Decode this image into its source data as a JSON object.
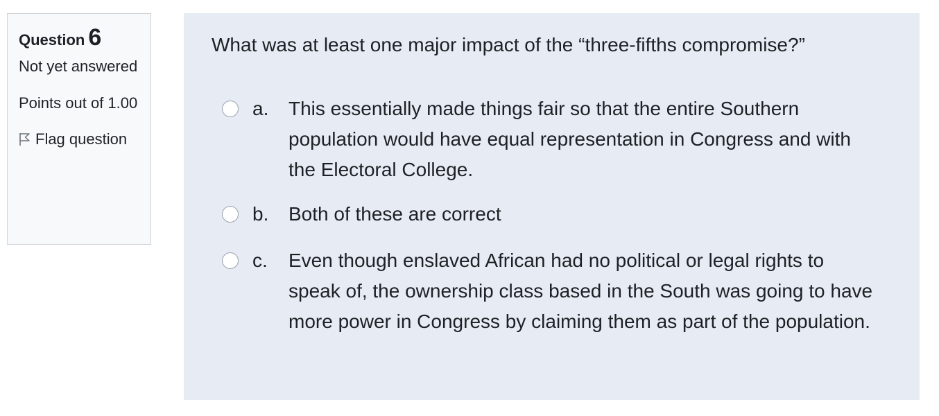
{
  "info": {
    "question_label": "Question",
    "question_number": "6",
    "state": "Not yet answered",
    "grade": "Points out of 1.00",
    "flag_label": "Flag question"
  },
  "question": {
    "text": "What was at least one major impact of the “three-fifths compromise?”",
    "answers": [
      {
        "letter": "a.",
        "text": "This essentially made things fair so that the entire Southern population would have equal representation in Congress and with the Electoral College.",
        "selected": false
      },
      {
        "letter": "b.",
        "text": "Both of these are correct",
        "selected": false
      },
      {
        "letter": "c.",
        "text": "Even though enslaved African had no political or legal rights to speak of, the ownership class based in the South was going to have more power in Congress by claiming them as part of the population.",
        "selected": false
      }
    ]
  }
}
